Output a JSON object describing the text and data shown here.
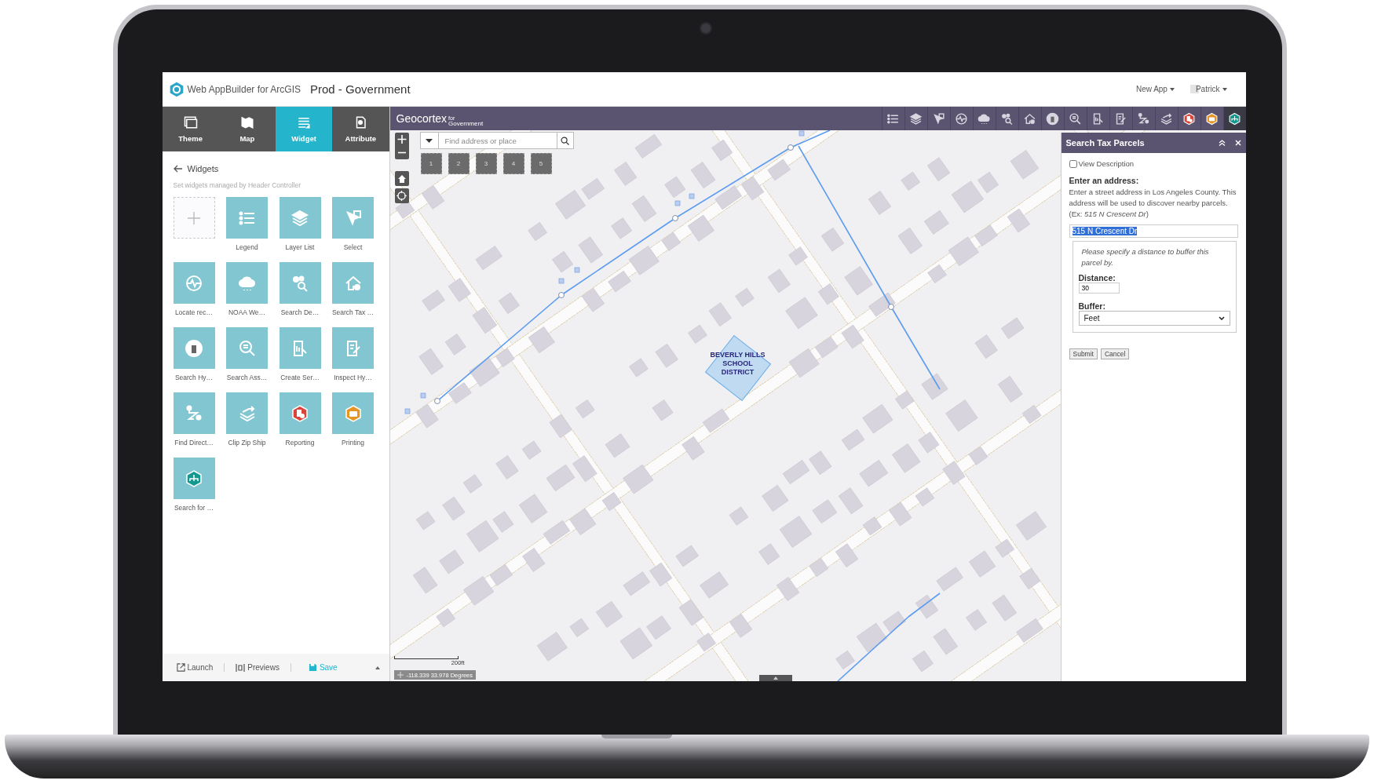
{
  "header": {
    "product": "Web AppBuilder for ArcGIS",
    "app_title": "Prod - Government",
    "new_app": "New App",
    "user": "Patrick"
  },
  "builder_tabs": [
    {
      "label": "Theme",
      "selected": false
    },
    {
      "label": "Map",
      "selected": false
    },
    {
      "label": "Widget",
      "selected": true
    },
    {
      "label": "Attribute",
      "selected": false
    }
  ],
  "widgets_panel": {
    "title": "Widgets",
    "subtitle": "Set widgets managed by Header Controller",
    "widgets": [
      {
        "label": "Legend"
      },
      {
        "label": "Layer List"
      },
      {
        "label": "Select"
      },
      {
        "label": "Locate rec…"
      },
      {
        "label": "NOAA We…"
      },
      {
        "label": "Search De…"
      },
      {
        "label": "Search Tax …"
      },
      {
        "label": "Search Hy…"
      },
      {
        "label": "Search Ass…"
      },
      {
        "label": "Create Ser…"
      },
      {
        "label": "Inspect Hy…"
      },
      {
        "label": "Find Direct…"
      },
      {
        "label": "Clip Zip Ship"
      },
      {
        "label": "Reporting"
      },
      {
        "label": "Printing"
      },
      {
        "label": "Search for …"
      }
    ]
  },
  "footer": {
    "launch": "Launch",
    "previews": "Previews",
    "save": "Save"
  },
  "app_header": {
    "brand": "Geocortex",
    "brand_small": "for",
    "brand_sub": "Government",
    "tools": [
      {
        "selected": false
      },
      {
        "selected": false
      },
      {
        "selected": false
      },
      {
        "selected": false
      },
      {
        "selected": false
      },
      {
        "selected": false
      },
      {
        "selected": false
      },
      {
        "selected": false
      },
      {
        "selected": false
      },
      {
        "selected": false
      },
      {
        "selected": false
      },
      {
        "selected": false
      },
      {
        "selected": false
      },
      {
        "selected": false
      },
      {
        "selected": false
      },
      {
        "selected": true
      }
    ]
  },
  "map": {
    "search_placeholder": "Find address or place",
    "bookmarks": [
      "1",
      "2",
      "3",
      "4",
      "5"
    ],
    "district_label": "BEVERLY HILLS SCHOOL DISTRICT",
    "scale": "200ft",
    "coordinates": "-118.339 33.978 Degrees"
  },
  "search_panel": {
    "title": "Search Tax Parcels",
    "view_description": {
      "label": "View Description",
      "checked": false
    },
    "heading": "Enter an address:",
    "description": "Enter a street address in Los Angeles County. This address will be used to discover nearby parcels.",
    "example": "(Ex: *515 N Crescent Dr*)",
    "address": {
      "value": "515 N Crescent Dr",
      "selected": true
    },
    "buffer_note": "Please specify a distance to buffer this parcel by.",
    "distance_label": "Distance:",
    "distance": "30",
    "buffer_label": "Buffer:",
    "buffer_unit": "Feet",
    "buttons": [
      "Submit",
      "Cancel"
    ]
  }
}
